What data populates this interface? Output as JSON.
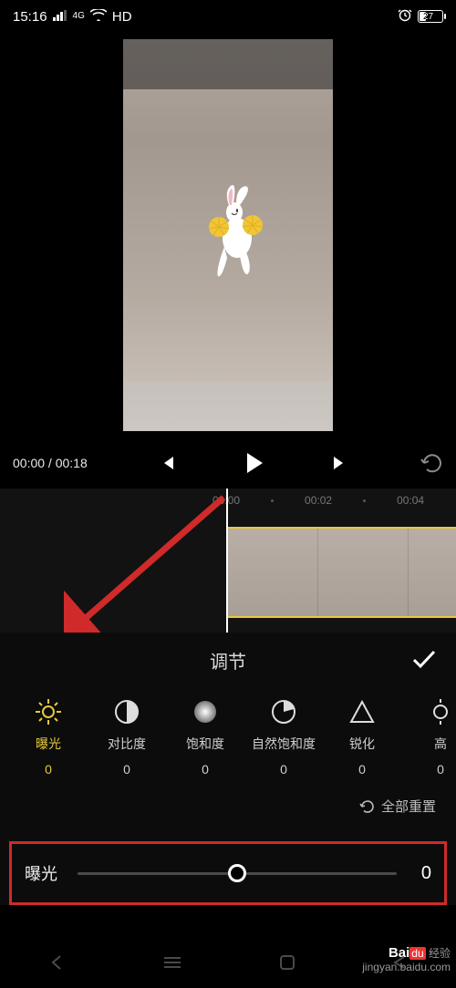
{
  "status": {
    "time": "15:16",
    "net": "HD",
    "battery_text": "27"
  },
  "transport": {
    "current": "00:00",
    "total": "00:18"
  },
  "timeline": {
    "ticks": [
      "00:00",
      "00:02",
      "00:04"
    ]
  },
  "panel": {
    "title": "调节",
    "reset_label": "全部重置",
    "items": [
      {
        "key": "exposure",
        "label": "曝光",
        "value": "0",
        "active": true
      },
      {
        "key": "contrast",
        "label": "对比度",
        "value": "0",
        "active": false
      },
      {
        "key": "saturation",
        "label": "饱和度",
        "value": "0",
        "active": false
      },
      {
        "key": "vibrance",
        "label": "自然饱和度",
        "value": "0",
        "active": false
      },
      {
        "key": "sharpen",
        "label": "锐化",
        "value": "0",
        "active": false
      },
      {
        "key": "highlight",
        "label": "高",
        "value": "0",
        "active": false
      }
    ]
  },
  "slider": {
    "label": "曝光",
    "value": "0"
  },
  "watermark": {
    "brand": "Bai",
    "brand2": "du",
    "brand3": "经验",
    "url": "jingyan.baidu.com"
  }
}
